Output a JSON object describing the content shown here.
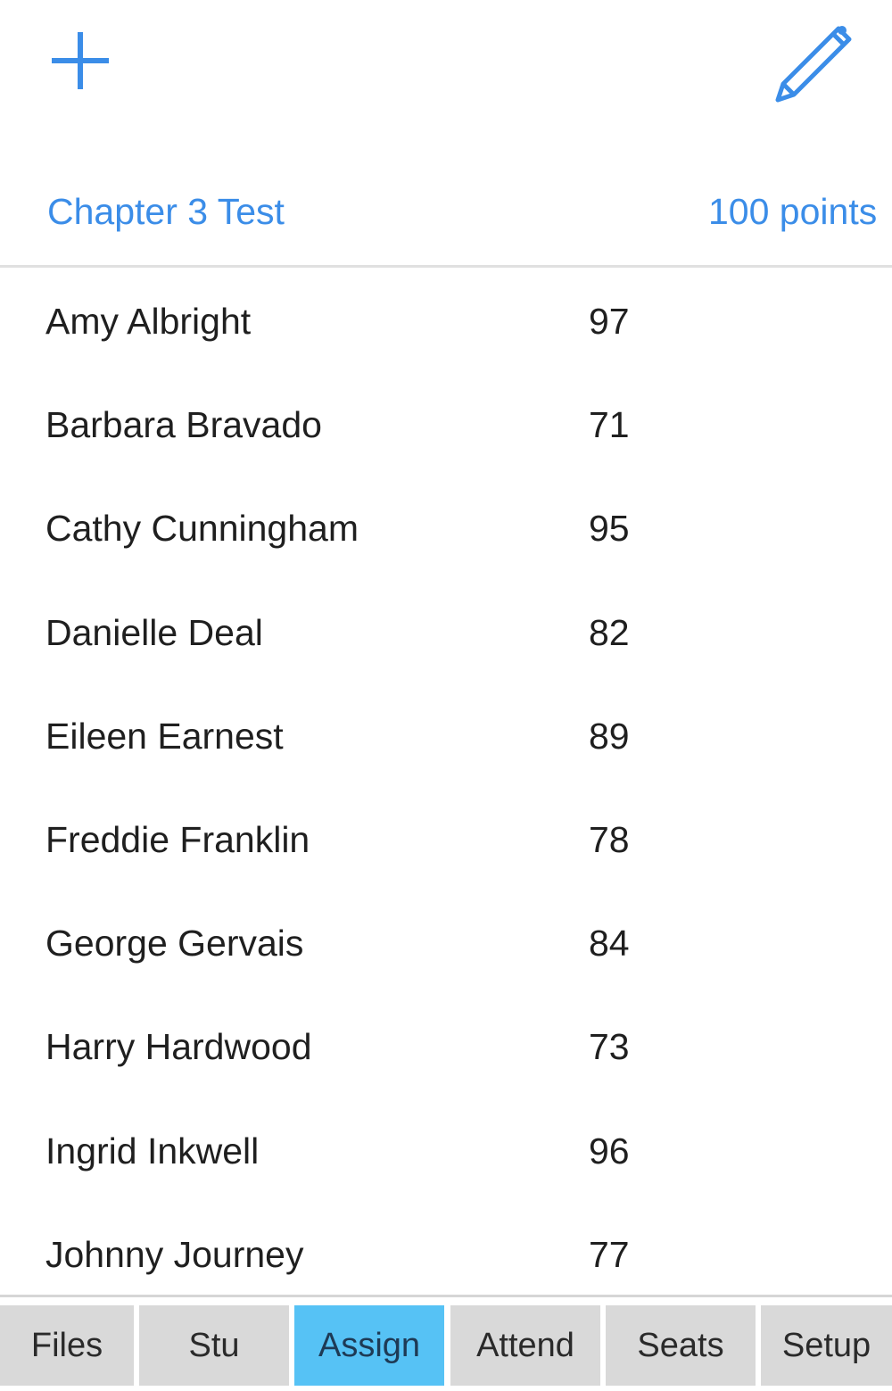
{
  "toolbar": {
    "add_icon": "plus-icon",
    "edit_icon": "pencil-icon",
    "accent_color": "#3b8de8"
  },
  "assignment": {
    "title": "Chapter 3 Test",
    "points": "100 points"
  },
  "students": [
    {
      "name": "Amy Albright",
      "score": "97"
    },
    {
      "name": "Barbara Bravado",
      "score": "71"
    },
    {
      "name": "Cathy Cunningham",
      "score": "95"
    },
    {
      "name": "Danielle Deal",
      "score": "82"
    },
    {
      "name": "Eileen Earnest",
      "score": "89"
    },
    {
      "name": "Freddie Franklin",
      "score": "78"
    },
    {
      "name": "George Gervais",
      "score": "84"
    },
    {
      "name": "Harry Hardwood",
      "score": "73"
    },
    {
      "name": "Ingrid Inkwell",
      "score": "96"
    },
    {
      "name": "Johnny Journey",
      "score": "77"
    }
  ],
  "tabs": [
    {
      "label": "Files",
      "active": false
    },
    {
      "label": "Stu",
      "active": false
    },
    {
      "label": "Assign",
      "active": true
    },
    {
      "label": "Attend",
      "active": false
    },
    {
      "label": "Seats",
      "active": false
    },
    {
      "label": "Setup",
      "active": false
    }
  ],
  "colors": {
    "active_tab": "#56c2f5",
    "inactive_tab": "#d9d9d9"
  }
}
